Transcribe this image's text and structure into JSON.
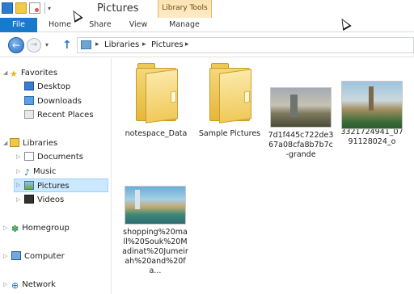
{
  "window": {
    "title": "Pictures",
    "context_group_label": "Library Tools"
  },
  "ribbon": {
    "tabs": [
      {
        "label": "File"
      },
      {
        "label": "Home"
      },
      {
        "label": "Share"
      },
      {
        "label": "View"
      },
      {
        "label": "Manage"
      }
    ]
  },
  "address": {
    "crumbs": [
      "Libraries",
      "Pictures"
    ],
    "separator": "▸"
  },
  "nav": {
    "favorites": {
      "label": "Favorites",
      "icon": "star-icon"
    },
    "favorites_items": [
      {
        "label": "Desktop",
        "icon": "desktop-icon"
      },
      {
        "label": "Downloads",
        "icon": "downloads-icon"
      },
      {
        "label": "Recent Places",
        "icon": "recent-places-icon"
      }
    ],
    "libraries": {
      "label": "Libraries",
      "icon": "libraries-icon"
    },
    "libraries_items": [
      {
        "label": "Documents",
        "icon": "documents-icon"
      },
      {
        "label": "Music",
        "icon": "music-icon"
      },
      {
        "label": "Pictures",
        "icon": "pictures-icon",
        "selected": true
      },
      {
        "label": "Videos",
        "icon": "videos-icon"
      }
    ],
    "homegroup": {
      "label": "Homegroup",
      "icon": "homegroup-icon"
    },
    "computer": {
      "label": "Computer",
      "icon": "computer-icon"
    },
    "network": {
      "label": "Network",
      "icon": "network-icon"
    }
  },
  "files": [
    {
      "name": "notespace_Data",
      "type": "folder"
    },
    {
      "name": "Sample Pictures",
      "type": "folder"
    },
    {
      "name": "7d1f445c722de367a08cfa8b7b7c-grande",
      "type": "image"
    },
    {
      "name": "3321724941_0791128024_o",
      "type": "image"
    },
    {
      "name": "shopping%20mall%20Souk%20Madinat%20Jumeirah%20and%20fa...",
      "type": "image"
    }
  ],
  "colors": {
    "accent": "#1979ca",
    "selection": "#cce8ff",
    "context_tab": "#fde9c3"
  }
}
